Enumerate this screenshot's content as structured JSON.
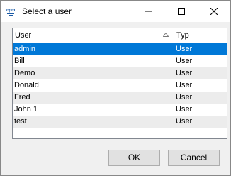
{
  "window": {
    "title": "Select a user",
    "app_icon": "cpm-app-icon",
    "controls": [
      "minimize-icon",
      "maximize-icon",
      "close-icon"
    ]
  },
  "list": {
    "columns": [
      "User",
      "Typ"
    ],
    "sorted_column": "User",
    "sort_direction": "ascending",
    "rows": [
      {
        "user": "admin",
        "type": "User",
        "selected": true
      },
      {
        "user": "Bill",
        "type": "User"
      },
      {
        "user": "Demo",
        "type": "User"
      },
      {
        "user": "Donald",
        "type": "User"
      },
      {
        "user": "Fred",
        "type": "User"
      },
      {
        "user": "John 1",
        "type": "User"
      },
      {
        "user": "test",
        "type": "User"
      }
    ]
  },
  "buttons": {
    "ok": "OK",
    "cancel": "Cancel"
  },
  "colors": {
    "selection": "#0078d7",
    "alt_row": "#ececec",
    "background": "#f0f0f0"
  }
}
